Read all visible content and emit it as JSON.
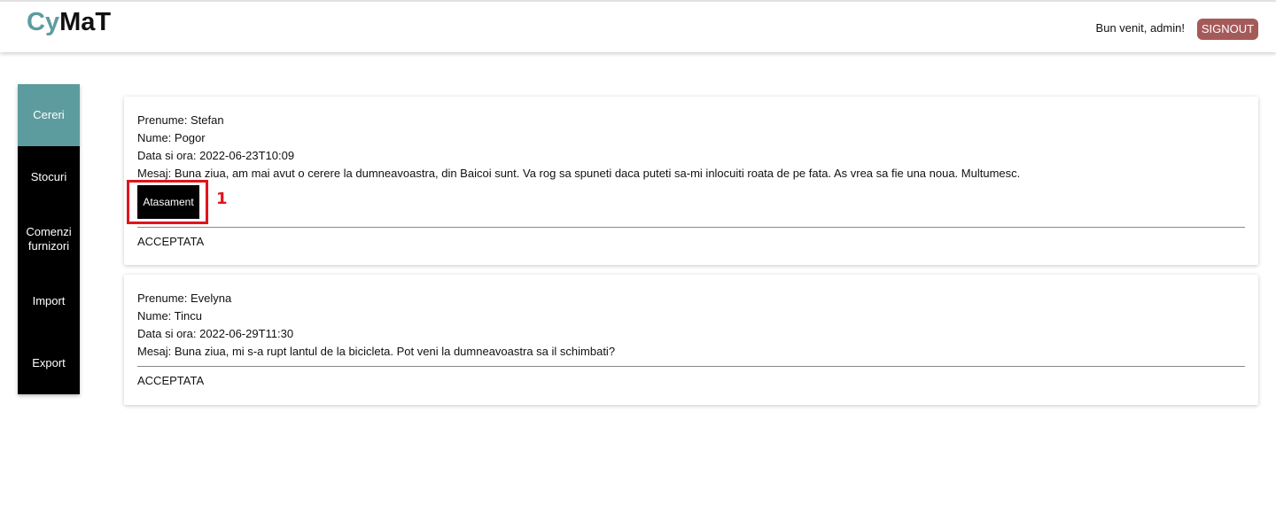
{
  "header": {
    "logo_part1": "Cy",
    "logo_part2": "MaT",
    "welcome_text": "Bun venit, admin!",
    "signout_label": "SIGNOUT"
  },
  "sidebar": {
    "items": [
      {
        "label": "Cereri",
        "active": true
      },
      {
        "label": "Stocuri"
      },
      {
        "label": "Comenzi furnizori"
      },
      {
        "label": "Import"
      },
      {
        "label": "Export"
      }
    ]
  },
  "requests": [
    {
      "prenume": "Prenume: Stefan",
      "nume": "Nume: Pogor",
      "data": "Data si ora: 2022-06-23T10:09",
      "mesaj": "Mesaj: Buna ziua, am mai avut o cerere la dumneavoastra, din Baicoi sunt. Va rog sa spuneti daca puteti sa-mi inlocuiti roata de pe fata. As vrea sa fie una noua. Multumesc.",
      "attachment_label": "Atasament",
      "status": "ACCEPTATA"
    },
    {
      "prenume": "Prenume: Evelyna",
      "nume": "Nume: Tincu",
      "data": "Data si ora: 2022-06-29T11:30",
      "mesaj": "Mesaj: Buna ziua, mi s-a rupt lantul de la bicicleta. Pot veni la dumneavoastra sa il schimbati?",
      "status": "ACCEPTATA"
    }
  ],
  "annotation": {
    "marker_label": "1"
  },
  "colors": {
    "accent": "#5d9c9e",
    "signout": "#a55a5a",
    "highlight": "#e0141e"
  }
}
